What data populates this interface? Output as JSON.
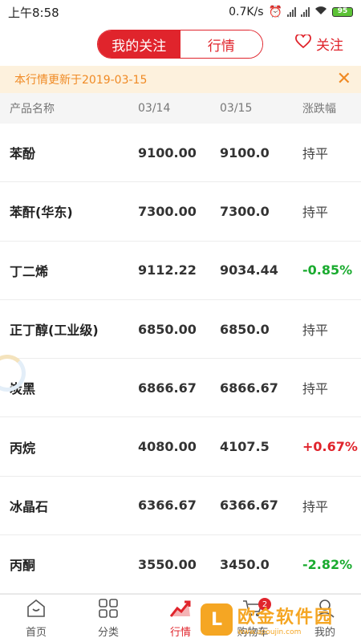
{
  "status_bar": {
    "time": "上午8:58",
    "net_speed": "0.7K/s",
    "battery": "95"
  },
  "header": {
    "tab_my_follow": "我的关注",
    "tab_market": "行情",
    "follow_label": "关注"
  },
  "notice": {
    "text": "本行情更新于2019-03-15"
  },
  "table": {
    "headers": [
      "产品名称",
      "03/14",
      "03/15",
      "涨跌幅"
    ],
    "rows": [
      {
        "name": "苯酚",
        "v1": "9100.00",
        "v2": "9100.0",
        "change": "持平",
        "trend": "flat"
      },
      {
        "name": "苯酐(华东)",
        "v1": "7300.00",
        "v2": "7300.0",
        "change": "持平",
        "trend": "flat"
      },
      {
        "name": "丁二烯",
        "v1": "9112.22",
        "v2": "9034.44",
        "change": "-0.85%",
        "trend": "down"
      },
      {
        "name": "正丁醇(工业级)",
        "v1": "6850.00",
        "v2": "6850.0",
        "change": "持平",
        "trend": "flat"
      },
      {
        "name": "炭黑",
        "v1": "6866.67",
        "v2": "6866.67",
        "change": "持平",
        "trend": "flat"
      },
      {
        "name": "丙烷",
        "v1": "4080.00",
        "v2": "4107.5",
        "change": "+0.67%",
        "trend": "up"
      },
      {
        "name": "冰晶石",
        "v1": "6366.67",
        "v2": "6366.67",
        "change": "持平",
        "trend": "flat"
      },
      {
        "name": "丙酮",
        "v1": "3550.00",
        "v2": "3450.0",
        "change": "-2.82%",
        "trend": "down"
      }
    ]
  },
  "tabbar": {
    "items": [
      {
        "label": "首页",
        "icon": "home-icon"
      },
      {
        "label": "分类",
        "icon": "grid-icon"
      },
      {
        "label": "行情",
        "icon": "trend-icon"
      },
      {
        "label": "购物车",
        "icon": "cart-icon",
        "badge": "2"
      },
      {
        "label": "我的",
        "icon": "user-icon"
      }
    ],
    "active_index": 2
  },
  "watermark": {
    "title": "欧金软件园",
    "url": "www.apoujin.com"
  },
  "colors": {
    "accent": "#e0242c",
    "down": "#1aab2f",
    "notice_text": "#f08a24",
    "notice_bg": "#fdf1dd"
  }
}
